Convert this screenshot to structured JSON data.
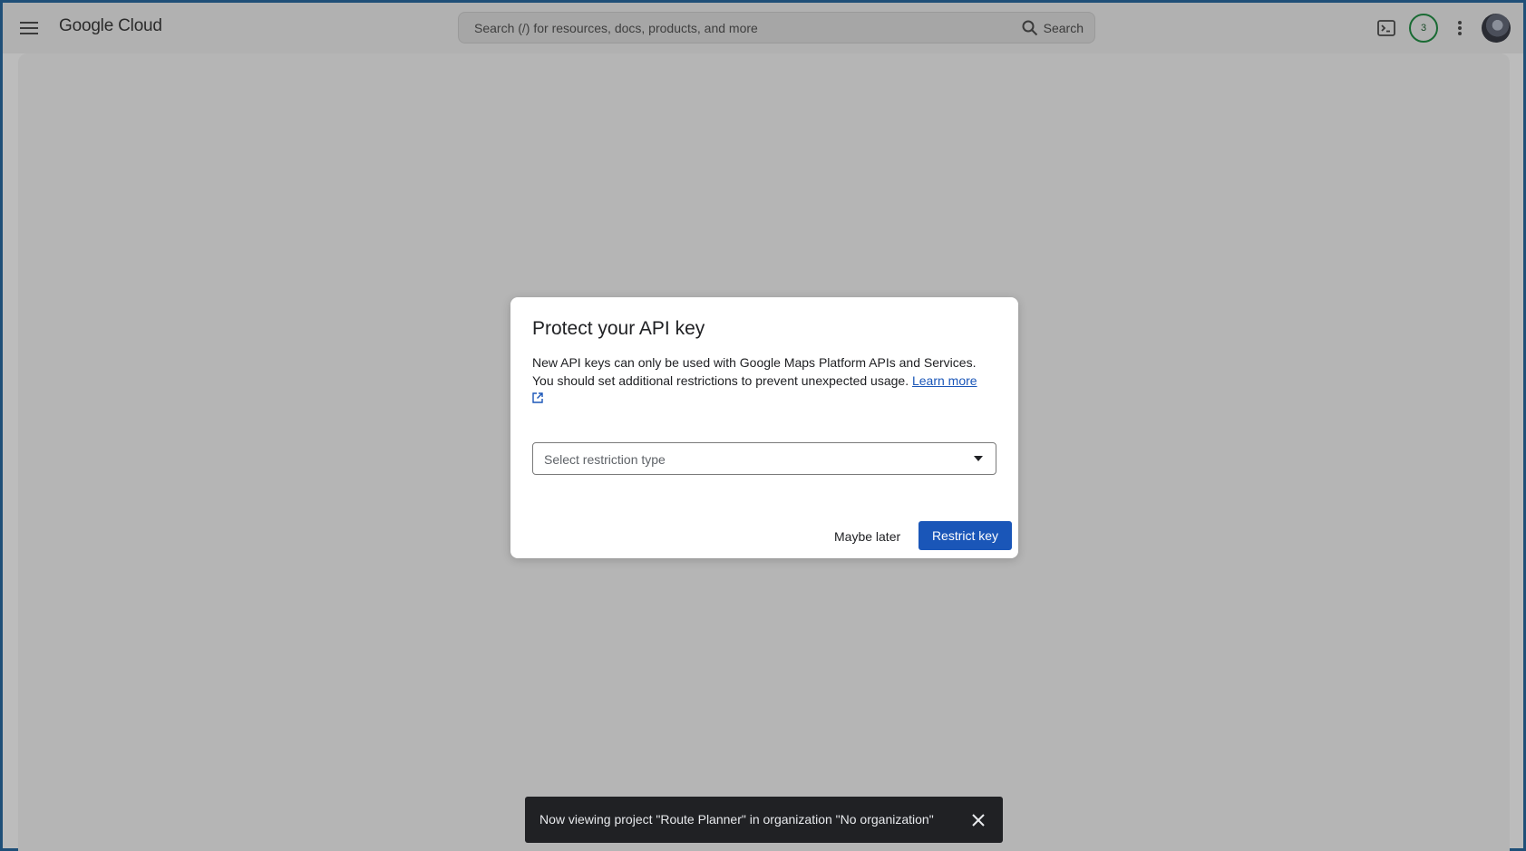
{
  "header": {
    "logo": "Google Cloud",
    "search_placeholder": "Search (/) for resources, docs, products, and more",
    "search_button": "Search",
    "notification_count": "3",
    "icons": [
      "menu-icon",
      "search-icon",
      "terminal-icon",
      "more-vert-icon",
      "avatar"
    ]
  },
  "dialog": {
    "title": "Protect your API key",
    "body": "New API keys can only be used with Google Maps Platform APIs and Services. You should set additional restrictions to prevent unexpected usage.",
    "learn_more": "Learn more",
    "select_placeholder": "Select restriction type",
    "secondary_button": "Maybe later",
    "primary_button": "Restrict key"
  },
  "snackbar": {
    "message": "Now viewing project \"Route Planner\" in organization \"No organization\""
  },
  "colors": {
    "primary": "#1a56b8",
    "snackbar_bg": "#202124",
    "badge_ring": "#1a6b34"
  }
}
